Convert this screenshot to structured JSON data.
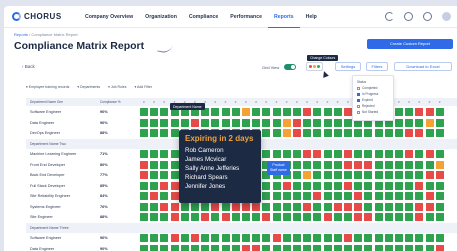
{
  "app": {
    "logo_text": "CHORUS",
    "nav": [
      "Company Overview",
      "Organization",
      "Compliance",
      "Performance",
      "Reports",
      "Help"
    ],
    "active_nav": "Reports",
    "nav_icons": [
      "moon-icon",
      "globe-icon",
      "settings-icon",
      "avatar"
    ]
  },
  "breadcrumb": {
    "root": "Reports",
    "sep": " / ",
    "current": "Compliance Matrix Report"
  },
  "page": {
    "title": "Compliance Matrix Report",
    "create_button": "Create Custom Report"
  },
  "toolbar": {
    "back": "Back",
    "grid_view": "Grid View",
    "change_colors": "Change Colours",
    "settings": "Settings",
    "filters": "Filters",
    "download": "Download to Excel",
    "color_dots": [
      "#e74c4c",
      "#f0a33a",
      "#27ae60"
    ]
  },
  "filters": [
    "Employee training records",
    "Departments",
    "Job Roles",
    "Add Filter"
  ],
  "filter_popup": {
    "title": "Status",
    "options": [
      {
        "label": "Completed",
        "checked": false
      },
      {
        "label": "In Progress",
        "checked": true
      },
      {
        "label": "Expired",
        "checked": true
      },
      {
        "label": "Rejected",
        "checked": false
      },
      {
        "label": "Not Started",
        "checked": false
      }
    ]
  },
  "matrix": {
    "col_name": "Department Name One",
    "col_pct": "Compliance %",
    "colors": {
      "green": "#2ea24f",
      "red": "#e64b48",
      "orange": "#f3a233"
    },
    "rows": [
      {
        "name": "Software Engineer",
        "pct": "96%",
        "cells": "ggggggggggogggggrgggrggggggrrg"
      },
      {
        "name": "Data Engineer",
        "pct": "96%",
        "cells": "gggggrggggggggorggggggggggggog"
      },
      {
        "name": "DevOps Engineer",
        "pct": "88%",
        "cells": "ggggggrgggggggorggggggggggrrgg"
      },
      {
        "name": "Department Name Two",
        "pct": "",
        "group": true
      },
      {
        "name": "Machine Learning Engineer",
        "pct": "71%",
        "cells": "ggggroggggrrggggrrggrgggggrgrg"
      },
      {
        "name": "Front End Developer",
        "pct": "80%",
        "cells": "rggggggggoggggggggggrrrggggggo"
      },
      {
        "name": "Back End Developer",
        "pct": "77%",
        "cells": "rgggggggrrggggggogggggggggggrr"
      },
      {
        "name": "Full Stack Developer",
        "pct": "85%",
        "cells": "ggrrgrggggrrggrgggggrggggggrgg"
      },
      {
        "name": "Site Reliability Engineer",
        "pct": "84%",
        "cells": "grgrrgggrrgrgggggrgggrggggggrg"
      },
      {
        "name": "Systems Engineer",
        "pct": "76%",
        "cells": "ggrrgggrgrrrggggrggrrrgggggrrg"
      },
      {
        "name": "Site Engineer",
        "pct": "88%",
        "cells": "gggrggrgrgggrgggggrggrrggggrgg"
      },
      {
        "name": "Department Name Three",
        "pct": "",
        "group": true
      },
      {
        "name": "Software Engineer",
        "pct": "96%",
        "cells": "gggrgrgggggggrggggggrggggggggg"
      },
      {
        "name": "Data Engineer",
        "pct": "90%",
        "cells": "ggggggggggrrgggggggggggggggggr"
      }
    ]
  },
  "tooltips": {
    "department_name": "Department Name",
    "expiring_head": "Expiring in 2 days",
    "people": [
      "Rob Cameron",
      "James Mcvicar",
      "Sally Anne Jefferies",
      "Richard Spears",
      "Jennifer Jones"
    ],
    "blue_line1": "Product",
    "blue_line2": "Staff name"
  }
}
